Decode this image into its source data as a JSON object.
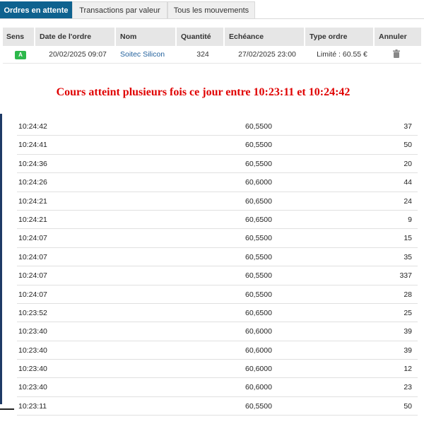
{
  "tabs": [
    {
      "label": "Ordres en attente",
      "active": true
    },
    {
      "label": "Transactions par valeur",
      "active": false
    },
    {
      "label": "Tous les mouvements",
      "active": false
    }
  ],
  "orders": {
    "headers": [
      "Sens",
      "Date de l'ordre",
      "Nom",
      "Quantité",
      "Echéance",
      "Type ordre",
      "Annuler"
    ],
    "rows": [
      {
        "sens": "A",
        "date": "20/02/2025 09:07",
        "nom": "Soitec Silicon",
        "quantite": "324",
        "echeance": "27/02/2025 23:00",
        "type": "Limité : 60.55 €",
        "annuler_icon": "trash-icon"
      }
    ]
  },
  "annotation": "Cours atteint plusieurs fois ce jour entre 10:23:11  et 10:24:42",
  "colors": {
    "tab_active": "#0e628f",
    "badge_buy": "#2db84b",
    "annotation": "#e00000",
    "link": "#1f5f9c",
    "left_rule": "#1e3a66"
  },
  "trades": [
    {
      "time": "10:24:42",
      "price": "60,5500",
      "qty": "37"
    },
    {
      "time": "10:24:41",
      "price": "60,5500",
      "qty": "50"
    },
    {
      "time": "10:24:36",
      "price": "60,5500",
      "qty": "20"
    },
    {
      "time": "10:24:26",
      "price": "60,6000",
      "qty": "44"
    },
    {
      "time": "10:24:21",
      "price": "60,6500",
      "qty": "24"
    },
    {
      "time": "10:24:21",
      "price": "60,6500",
      "qty": "9"
    },
    {
      "time": "10:24:07",
      "price": "60,5500",
      "qty": "15"
    },
    {
      "time": "10:24:07",
      "price": "60,5500",
      "qty": "35"
    },
    {
      "time": "10:24:07",
      "price": "60,5500",
      "qty": "337"
    },
    {
      "time": "10:24:07",
      "price": "60,5500",
      "qty": "28"
    },
    {
      "time": "10:23:52",
      "price": "60,6500",
      "qty": "25"
    },
    {
      "time": "10:23:40",
      "price": "60,6000",
      "qty": "39"
    },
    {
      "time": "10:23:40",
      "price": "60,6000",
      "qty": "39"
    },
    {
      "time": "10:23:40",
      "price": "60,6000",
      "qty": "12"
    },
    {
      "time": "10:23:40",
      "price": "60,6000",
      "qty": "23"
    },
    {
      "time": "10:23:11",
      "price": "60,5500",
      "qty": "50"
    }
  ]
}
